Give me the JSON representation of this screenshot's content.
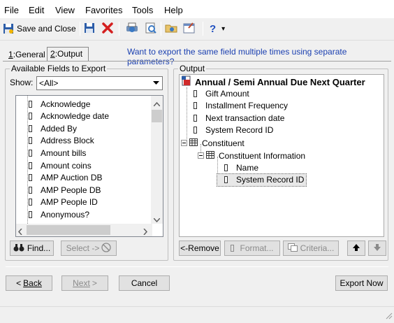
{
  "menu": [
    "File",
    "Edit",
    "View",
    "Favorites",
    "Tools",
    "Help"
  ],
  "toolbar": {
    "save_close_label": "Save and Close",
    "help_label": "?",
    "dropdown_arrow": "▾"
  },
  "tabs": {
    "general": {
      "prefix": "1",
      "label": ":General"
    },
    "output": {
      "prefix": "2",
      "label": ":Output"
    }
  },
  "hint_text": "Want to export the same field multiple times using separate parameters?",
  "available": {
    "group_label": "Available Fields to Export",
    "show_label": "Show:",
    "show_value": "<All>",
    "fields": [
      "Acknowledge",
      "Acknowledge date",
      "Added By",
      "Address Block",
      "Amount bills",
      "Amount coins",
      "AMP Auction DB",
      "AMP People DB",
      "AMP People ID",
      "Anonymous?"
    ],
    "find_label": "Find...",
    "select_label": "Select ->"
  },
  "output": {
    "group_label": "Output",
    "root": "Annual / Semi Annual Due Next Quarter",
    "fields": [
      "Gift Amount",
      "Installment Frequency",
      "Next transaction date",
      "System Record ID"
    ],
    "constituent": "Constituent",
    "constituent_info": "Constituent Information",
    "info_fields": [
      "Name",
      "System Record ID"
    ],
    "remove_label": "<-Remove",
    "format_label": "Format...",
    "criteria_label": "Criteria...",
    "up_arrow": "🡅",
    "down_arrow": "🡇"
  },
  "nav": {
    "back_label": "Back",
    "next_label": "Next",
    "cancel_label": "Cancel",
    "export_label": "Export Now"
  }
}
